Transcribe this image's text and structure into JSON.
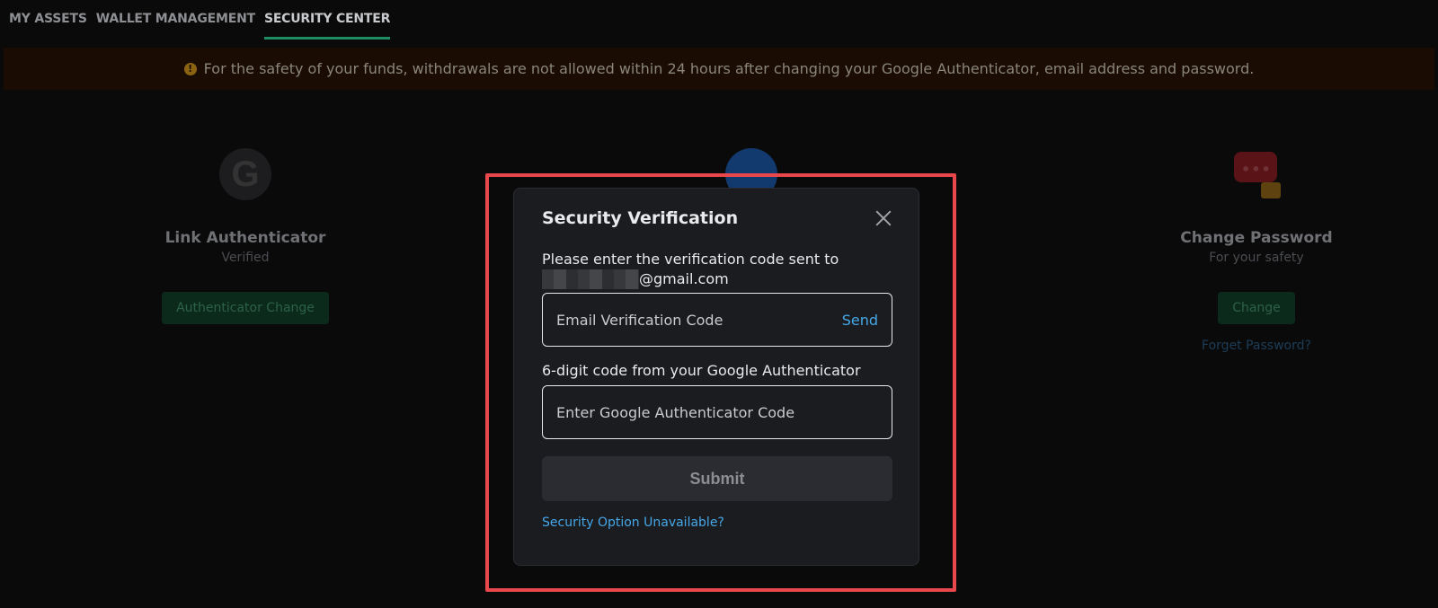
{
  "nav": {
    "tabs": [
      "MY ASSETS",
      "WALLET MANAGEMENT",
      "SECURITY CENTER"
    ]
  },
  "banner": {
    "text": "For the safety of your funds, withdrawals are not allowed within 24 hours after changing your Google Authenticator, email address and password."
  },
  "cards": {
    "google": {
      "title": "Link Authenticator",
      "subtitle": "Verified",
      "button": "Authenticator Change"
    },
    "password": {
      "title": "Change Password",
      "subtitle": "For your safety",
      "button": "Change",
      "link": "Forget Password?"
    }
  },
  "modal": {
    "title": "Security Verification",
    "prompt": "Please enter the verification code sent to",
    "email_suffix": "@gmail.com",
    "email_placeholder": "Email Verification Code",
    "send_label": "Send",
    "ga_label": "6-digit code from your Google Authenticator",
    "ga_placeholder": "Enter Google Authenticator Code",
    "submit_label": "Submit",
    "unavailable_link": "Security Option Unavailable?"
  },
  "colors": {
    "accent_link": "#45a7e8",
    "highlight": "#e8474c",
    "active_tab_underline": "#1f8f63"
  }
}
